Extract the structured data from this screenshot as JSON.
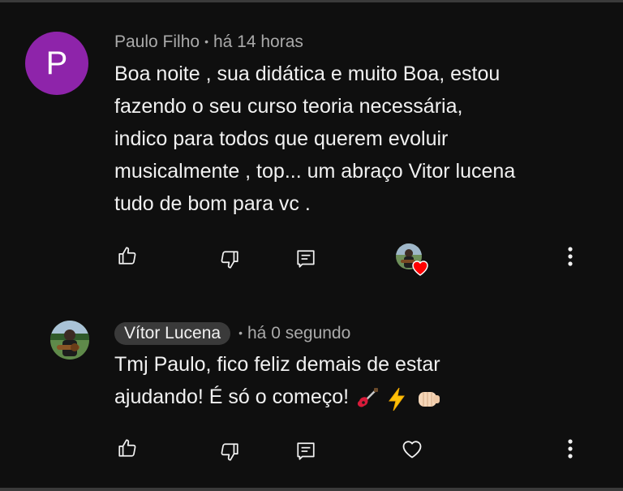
{
  "comments": [
    {
      "avatar_letter": "P",
      "avatar_color": "#8e24aa",
      "author": "Paulo Filho",
      "separator": "•",
      "time": "há 14 horas",
      "text": "Boa noite , sua didática e muito Boa,  estou\nfazendo o seu curso teoria necessária,\nindico para todos que  querem  evoluir\nmusicalmente , top... um abraço Vitor lucena\ntudo de bom para vc .",
      "actions": [
        "thumb-up-icon",
        "thumb-down-icon",
        "reply-icon",
        "creator-heart",
        "more-vert-icon"
      ]
    }
  ],
  "reply": {
    "author": "Vítor Lucena",
    "separator": "•",
    "time": "há 0 segundo",
    "text": "Tmj Paulo, fico feliz demais de estar\najudando! É só o começo!",
    "emojis": [
      "guitar-emoji",
      "lightning-emoji",
      "fist-emoji"
    ],
    "actions": [
      "thumb-up-icon",
      "thumb-down-icon",
      "reply-icon",
      "heart-outline-icon",
      "more-vert-icon"
    ]
  },
  "colors": {
    "background": "#0f0f0f",
    "text_primary": "#f1f1f1",
    "text_secondary": "#aaaaaa",
    "heart": "#ff0000",
    "author_chip": "#3a3a3a"
  }
}
